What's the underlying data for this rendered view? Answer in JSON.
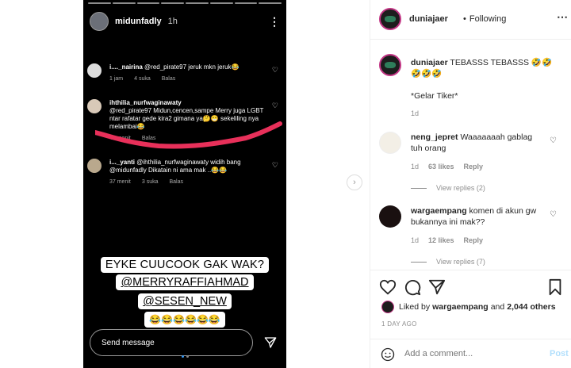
{
  "story": {
    "username": "midunfadly",
    "time": "1h",
    "comments": [
      {
        "user": "i...._nairina",
        "text": "@red_pirate97 jeruk mkn jeruk😂",
        "time": "1 jam",
        "likes": "4 suka",
        "reply": "Balas"
      },
      {
        "user": "ihthilia_nurfwaginawaty",
        "text": "@red_pirate97 Midun,cencen,sampe Merry juga LGBT ntar rafatar gede kira2 gimana ya🤔😁 sekeliling nya melambai😂",
        "time": "43 menit",
        "likes": "",
        "reply": "Balas"
      },
      {
        "user": "i..._yanti",
        "text": "@ihthilia_nurfwaginawaty widih bang @midunfadly Dikatain ni ama mak ..😂😂",
        "time": "37 menit",
        "likes": "3 suka",
        "reply": "Balas"
      }
    ],
    "captions": [
      "EYKE CUUCOOK GAK WAK?",
      "@MERRYRAFFIAHMAD",
      "@SESEN_NEW",
      "😂😂😂😂😂😂"
    ],
    "send_placeholder": "Send message",
    "colors": {
      "scribble": "#e8305a"
    }
  },
  "post": {
    "username": "duniajaer",
    "following": "Following",
    "caption_user": "duniajaer",
    "caption_text": "TEBASSS TEBASSS 🤣🤣🤣🤣🤣",
    "caption_sub": "*Gelar Tiker*",
    "caption_time": "1d",
    "comments": [
      {
        "user": "neng_jepret",
        "text": "Waaaaaaah gablag tuh orang",
        "time": "1d",
        "likes": "63 likes",
        "reply": "Reply",
        "view": "View replies (2)"
      },
      {
        "user": "wargaempang",
        "text": "komen di akun gw bukannya ini mak??",
        "time": "1d",
        "likes": "12 likes",
        "reply": "Reply",
        "view": "View replies (7)"
      }
    ],
    "liked_by_prefix": "Liked by",
    "liked_by_user": "wargaempang",
    "liked_by_and": "and",
    "liked_count": "2,044 others",
    "posted": "1 DAY AGO",
    "add_comment_placeholder": "Add a comment...",
    "post_label": "Post"
  }
}
